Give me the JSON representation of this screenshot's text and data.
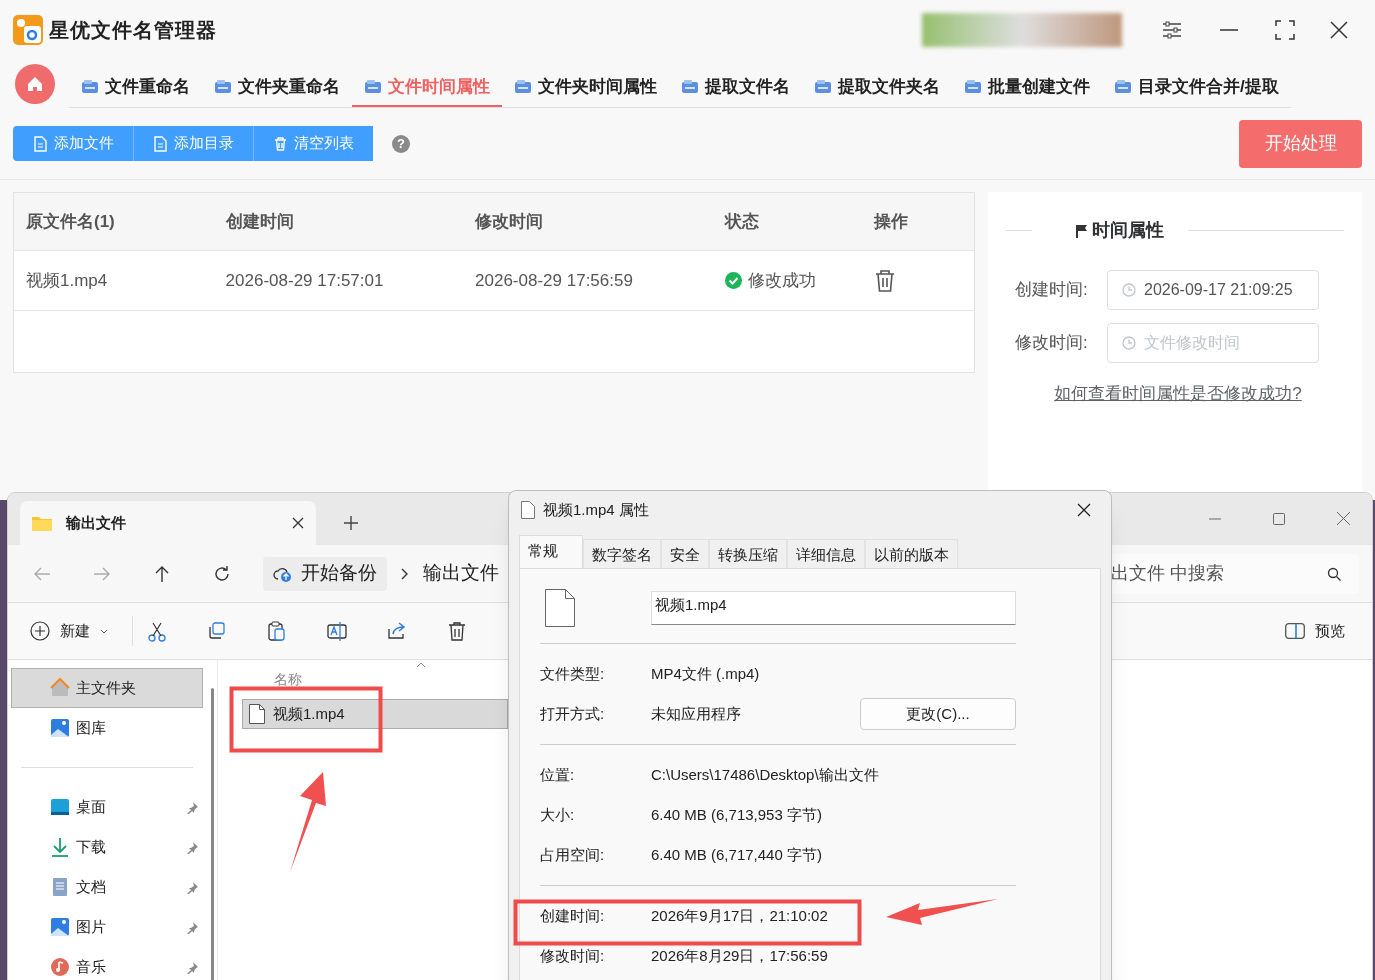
{
  "app": {
    "title": "星优文件名管理器",
    "nav": [
      {
        "label": "文件重命名",
        "selected": false
      },
      {
        "label": "文件夹重命名",
        "selected": false
      },
      {
        "label": "文件时间属性",
        "selected": true
      },
      {
        "label": "文件夹时间属性",
        "selected": false
      },
      {
        "label": "提取文件名",
        "selected": false
      },
      {
        "label": "提取文件夹名",
        "selected": false
      },
      {
        "label": "批量创建文件",
        "selected": false
      },
      {
        "label": "目录文件合并/提取",
        "selected": false
      }
    ],
    "toolbar_buttons": [
      {
        "label": "添加文件",
        "kind": "file"
      },
      {
        "label": "添加目录",
        "kind": "file"
      },
      {
        "label": "清空列表",
        "kind": "trash"
      }
    ],
    "help_button": "?",
    "start_button": "开始处理",
    "table": {
      "columns": [
        "原文件名(1)",
        "创建时间",
        "修改时间",
        "状态",
        "操作"
      ],
      "rows": [
        {
          "name": "视频1.mp4",
          "created": "2026-08-29 17:57:01",
          "modified": "2026-08-29 17:56:59",
          "status": "修改成功",
          "success": true
        }
      ]
    },
    "time_panel": {
      "title": "时间属性",
      "fields": [
        {
          "label": "创建时间:",
          "value": "2026-09-17 21:09:25"
        },
        {
          "label": "修改时间:",
          "placeholder": "文件修改时间"
        }
      ],
      "help_link": "如何查看时间属性是否修改成功?"
    }
  },
  "explorer": {
    "tab_title": "输出文件",
    "breadcrumb": [
      "开始备份",
      "输出文件"
    ],
    "search_placeholder": "出文件 中搜索",
    "new_button": "新建",
    "preview_button": "预览",
    "sidebar_groups": [
      [
        {
          "label": "主文件夹",
          "kind": "home",
          "selected": true,
          "pinned": false
        },
        {
          "label": "图库",
          "kind": "gallery",
          "selected": false,
          "pinned": false
        }
      ],
      [
        {
          "label": "桌面",
          "kind": "desktop",
          "selected": false,
          "pinned": true
        },
        {
          "label": "下载",
          "kind": "download",
          "selected": false,
          "pinned": true
        },
        {
          "label": "文档",
          "kind": "document",
          "selected": false,
          "pinned": true
        },
        {
          "label": "图片",
          "kind": "gallery",
          "selected": false,
          "pinned": true
        },
        {
          "label": "音乐",
          "kind": "music",
          "selected": false,
          "pinned": true
        }
      ]
    ],
    "column": "名称",
    "files": [
      {
        "name": "视频1.mp4",
        "selected": true
      }
    ]
  },
  "properties": {
    "title": "视频1.mp4 属性",
    "tabs": [
      {
        "label": "常规",
        "selected": true
      },
      {
        "label": "数字签名",
        "selected": false
      },
      {
        "label": "安全",
        "selected": false
      },
      {
        "label": "转换压缩",
        "selected": false
      },
      {
        "label": "详细信息",
        "selected": false
      },
      {
        "label": "以前的版本",
        "selected": false
      }
    ],
    "file_name": "视频1.mp4",
    "sections": [
      [
        {
          "label": "文件类型:",
          "value": "MP4文件 (.mp4)"
        },
        {
          "label": "打开方式:",
          "value": "未知应用程序",
          "button": "更改(C)..."
        }
      ],
      [
        {
          "label": "位置:",
          "value": "C:\\Users\\17486\\Desktop\\输出文件"
        },
        {
          "label": "大小:",
          "value": "6.40 MB (6,713,953 字节)"
        },
        {
          "label": "占用空间:",
          "value": "6.40 MB (6,717,440 字节)"
        }
      ],
      [
        {
          "label": "创建时间:",
          "value": "2026年9月17日，21:10:02"
        },
        {
          "label": "修改时间:",
          "value": "2026年8月29日，17:56:59"
        }
      ]
    ]
  }
}
